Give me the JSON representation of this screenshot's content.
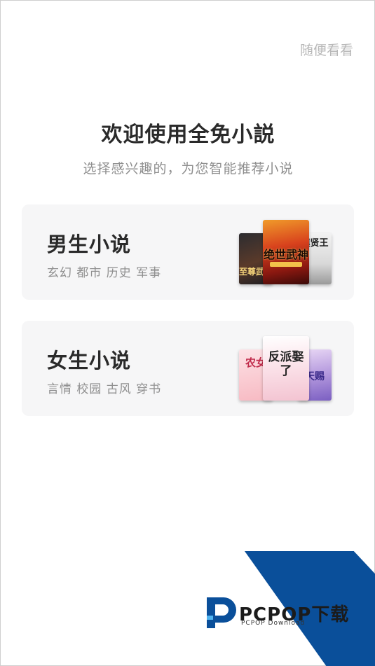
{
  "skip_label": "随便看看",
  "title": "欢迎使用全免小説",
  "subtitle": "选择感兴趣的，为您智能推荐小说",
  "cards": [
    {
      "title": "男生小说",
      "tags": "玄幻 都市 历史 军事",
      "covers": [
        "至尊武神",
        "绝世武神",
        "镇贤王"
      ]
    },
    {
      "title": "女生小说",
      "tags": "言情 校园 古风 穿书",
      "covers": [
        "农女",
        "反派娶了",
        "天赐"
      ]
    }
  ],
  "watermark": {
    "brand": "PCPOP下载",
    "sub": "PCPOP Download"
  },
  "colors": {
    "card_bg": "#f6f6f7",
    "skip_text": "#b8b8b8",
    "watermark_blue": "#0a4f9a"
  }
}
